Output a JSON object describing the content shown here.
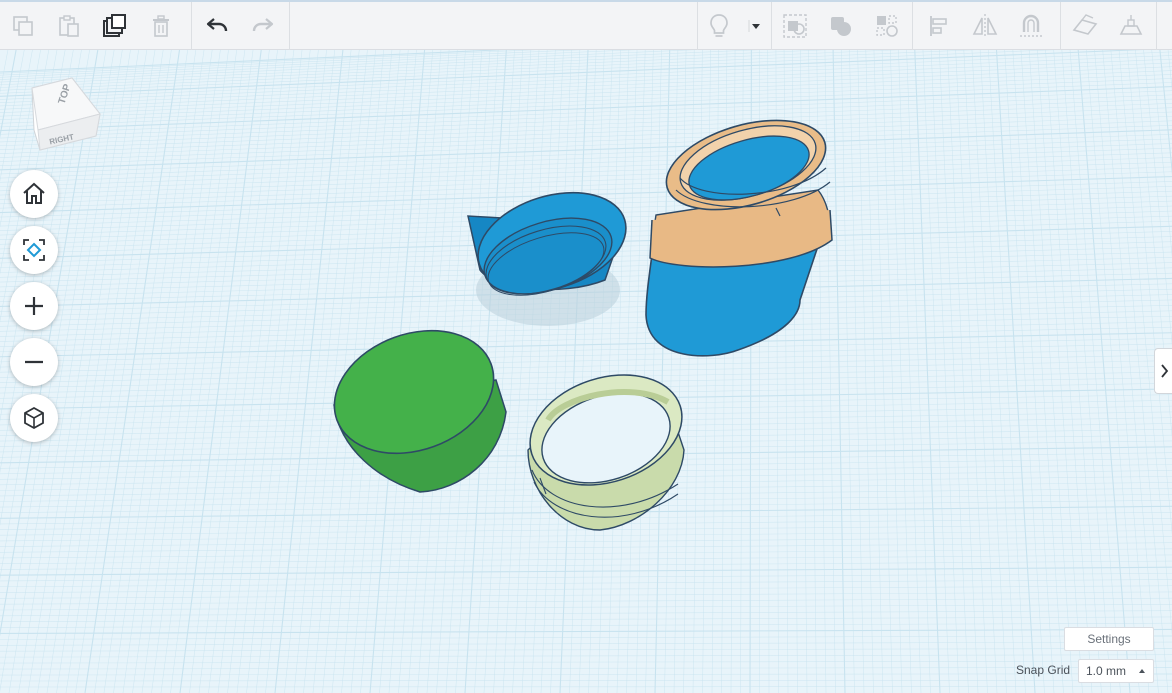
{
  "toolbar": {
    "edit_group": [
      {
        "name": "copy-icon",
        "enabled": false
      },
      {
        "name": "paste-icon",
        "enabled": false
      },
      {
        "name": "duplicate-icon",
        "enabled": true
      },
      {
        "name": "delete-icon",
        "enabled": false
      }
    ],
    "history_group": [
      {
        "name": "undo-icon",
        "enabled": true
      },
      {
        "name": "redo-icon",
        "enabled": false
      }
    ],
    "right_group": [
      {
        "name": "lightbulb-icon"
      },
      {
        "name": "dropdown-caret-icon"
      },
      {
        "name": "group-icon"
      },
      {
        "name": "solid-hole-icon"
      },
      {
        "name": "ungroup-icon"
      },
      {
        "name": "align-icon"
      },
      {
        "name": "mirror-icon"
      },
      {
        "name": "cruise-icon"
      },
      {
        "name": "workplane-icon"
      },
      {
        "name": "ruler-icon"
      }
    ]
  },
  "viewcube": {
    "top_label": "TOP",
    "right_label": "RIGHT"
  },
  "nav_buttons": [
    {
      "name": "home-view-icon"
    },
    {
      "name": "fit-view-icon"
    },
    {
      "name": "zoom-in-icon"
    },
    {
      "name": "zoom-out-icon"
    },
    {
      "name": "perspective-icon"
    }
  ],
  "shapes": [
    {
      "name": "blue-lid",
      "color": "#1f9ad6"
    },
    {
      "name": "jar-body",
      "color": "#1f9ad6",
      "thread_color": "#e8b985"
    },
    {
      "name": "green-disc",
      "color": "#44b14a"
    },
    {
      "name": "thread-ring",
      "color": "#dbe9c3"
    }
  ],
  "colors": {
    "grid_bg": "#e8f4fa",
    "grid_line": "#c7e3ef",
    "outline": "#2e4a66"
  },
  "settings": {
    "label": "Settings"
  },
  "snap_grid": {
    "label": "Snap Grid",
    "value": "1.0 mm"
  }
}
